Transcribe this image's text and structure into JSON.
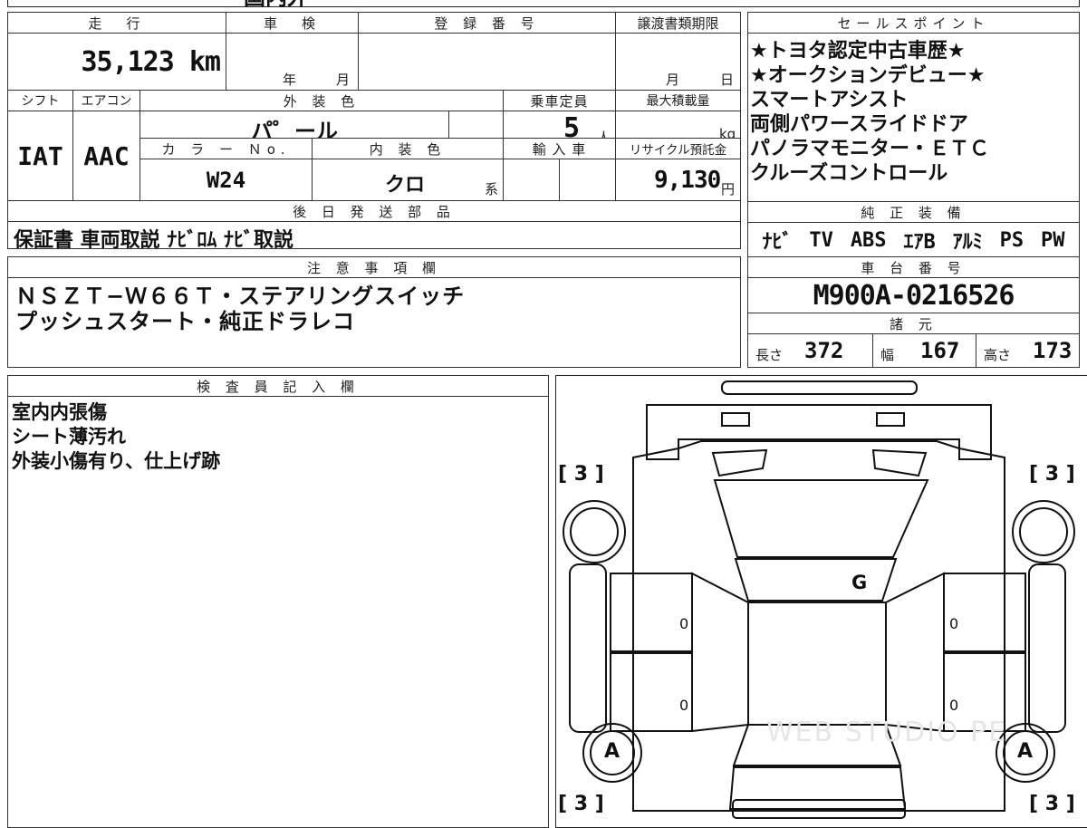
{
  "top_strip": {
    "partial_text": "国内外"
  },
  "mileage": {
    "label": "走　行",
    "value": "35,123 km"
  },
  "inspection": {
    "label": "車　検",
    "year_unit": "年",
    "month_unit": "月"
  },
  "registration": {
    "label": "登 録 番 号",
    "value": ""
  },
  "transfer_deadline": {
    "label": "譲渡書類期限",
    "month_unit": "月",
    "day_unit": "日"
  },
  "shift": {
    "label": "シフト",
    "value": "IAT"
  },
  "aircon": {
    "label": "エアコン",
    "value": "AAC"
  },
  "exterior_color": {
    "label": "外 装 色",
    "value": "パ゜ール"
  },
  "capacity": {
    "label": "乗車定員",
    "value": "5",
    "unit": "人"
  },
  "max_load": {
    "label": "最大積載量",
    "unit": "kg"
  },
  "color_no": {
    "label": "カ ラ ー Ｎo.",
    "value": "W24"
  },
  "interior_color": {
    "label": "内 装 色",
    "value": "クロ",
    "suffix": "系"
  },
  "import_car": {
    "label": "輸 入 車"
  },
  "recycle_fee": {
    "label": "リサイクル預託金",
    "value": "9,130",
    "unit": "円"
  },
  "later_shipping": {
    "label": "後 日 発 送 部 品",
    "value": "保証書 車両取説 ﾅﾋﾞﾛﾑ ﾅﾋﾞ取説"
  },
  "sales_points": {
    "label": "セールスポイント",
    "lines": [
      "★トヨタ認定中古車歴★",
      "★オークションデビュー★",
      "スマートアシスト",
      "両側パワースライドドア",
      "パノラマモニター・ＥＴＣ",
      "クルーズコントロール"
    ]
  },
  "genuine_equipment": {
    "label": "純 正 装 備",
    "items": [
      "ﾅﾋﾞ",
      "TV",
      "ABS",
      "ｴｱB",
      "ｱﾙﾐ",
      "PS",
      "PW"
    ]
  },
  "caution": {
    "label": "注 意 事 項 欄",
    "lines": [
      "ＮＳＺＴ−Ｗ６６Ｔ・ステアリングスイッチ",
      "プッシュスタート・純正ドラレコ"
    ]
  },
  "chassis": {
    "label": "車 台 番 号",
    "value": "M900A-0216526"
  },
  "specs": {
    "label": "諸 元",
    "length_label": "長さ",
    "length": "372",
    "width_label": "幅",
    "width": "167",
    "height_label": "高さ",
    "height": "173"
  },
  "inspector": {
    "label": "検 査 員 記 入 欄",
    "lines": [
      "室内内張傷",
      "シート薄汚れ",
      "外装小傷有り、仕上げ跡"
    ]
  },
  "diagram": {
    "tire_mark": "3",
    "wheel_grade": "A",
    "glass_mark": "G",
    "door_mark": "0",
    "watermark": "WEB STUDIO PE"
  }
}
